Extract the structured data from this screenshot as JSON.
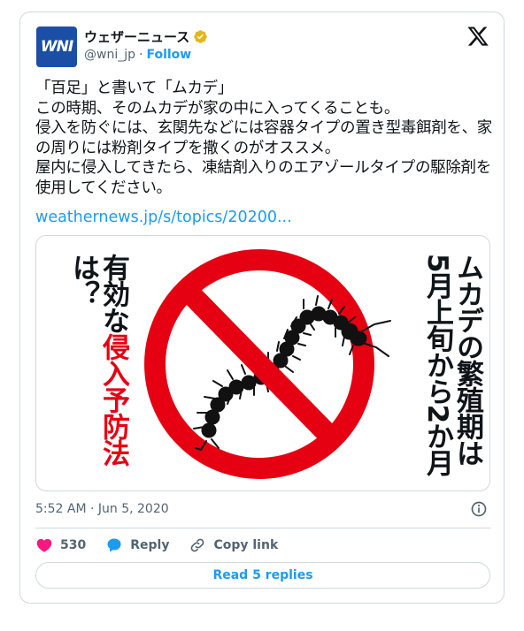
{
  "account": {
    "avatar_text": "WNI",
    "display_name": "ウェザーニュース",
    "handle": "@wni_jp",
    "separator": "·",
    "follow_label": "Follow"
  },
  "tweet": {
    "text": "「百足」と書いて「ムカデ」\nこの時期、そのムカデが家の中に入ってくることも。\n侵入を防ぐには、玄関先などには容器タイプの置き型毒餌剤を、家の周りには粉剤タイプを撒くのがオススメ。\n屋内に侵入してきたら、凍結剤入りのエアゾールタイプの駆除剤を使用してください。",
    "link": "weathernews.jp/s/topics/20200..."
  },
  "media": {
    "left_text_black_top": "有効な",
    "left_text_red": "侵入予防法",
    "left_text_black_bottom": "は？",
    "right_col1": "ムカデの繁殖期は",
    "right_col2": "5月上旬から2か月"
  },
  "meta": {
    "timestamp": "5:52 AM · Jun 5, 2020"
  },
  "actions": {
    "like_count": "530",
    "reply_label": "Reply",
    "copy_label": "Copy link",
    "read_replies_label": "Read 5 replies"
  },
  "colors": {
    "accent": "#1d9bf0",
    "like": "#f91880",
    "stop_red": "#e50012",
    "avatar": "#1b4fa6"
  }
}
